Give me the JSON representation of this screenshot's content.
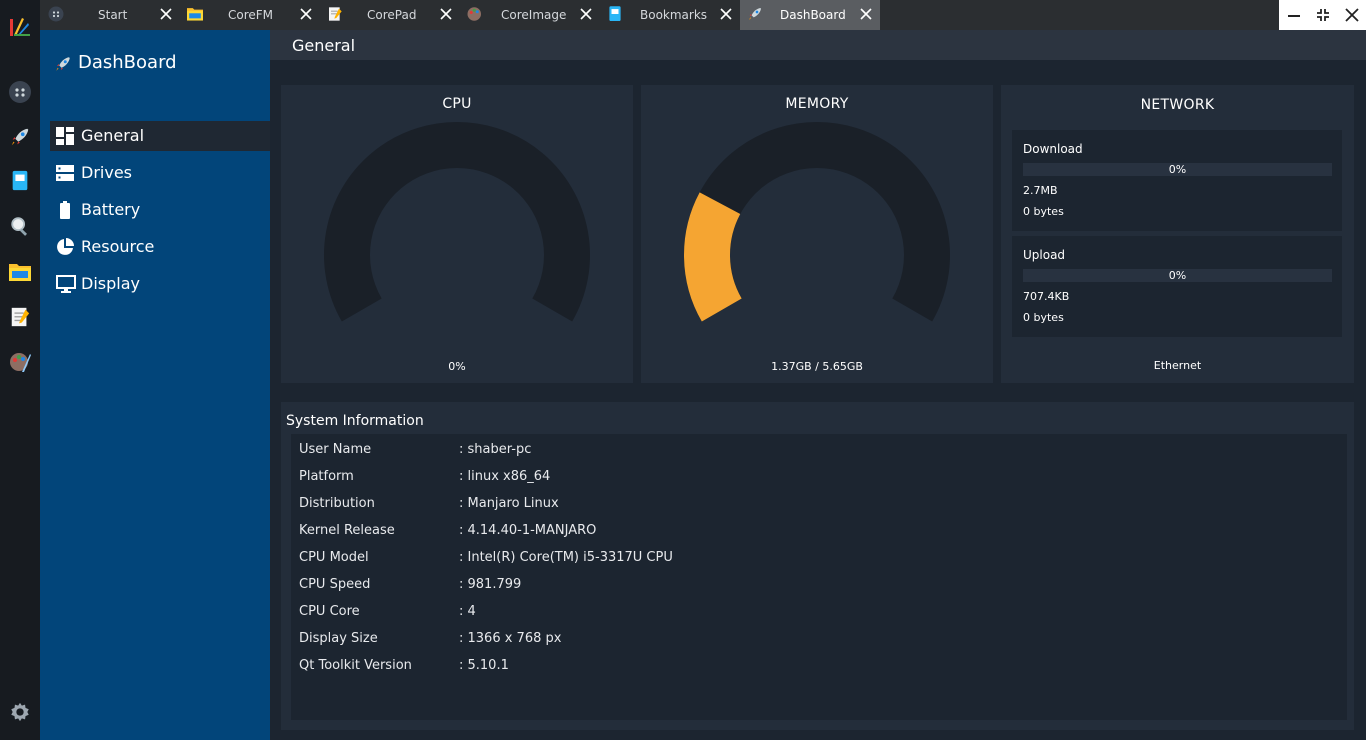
{
  "dock": {
    "items": [
      "corestuff-logo-icon",
      "start-icon",
      "dashboard-icon",
      "bookmarks-icon",
      "search-icon",
      "folder-icon",
      "notepad-icon",
      "coreimage-icon",
      "settings-icon"
    ]
  },
  "tabs": [
    {
      "label": "Start",
      "icon": "start-icon"
    },
    {
      "label": "CoreFM",
      "icon": "folder-icon"
    },
    {
      "label": "CorePad",
      "icon": "notepad-icon"
    },
    {
      "label": "CoreImage",
      "icon": "coreimage-icon"
    },
    {
      "label": "Bookmarks",
      "icon": "bookmarks-icon"
    },
    {
      "label": "DashBoard",
      "icon": "rocket-icon",
      "active": true
    }
  ],
  "sidebar": {
    "title": "DashBoard",
    "items": [
      {
        "label": "General",
        "icon": "grid-icon",
        "active": true
      },
      {
        "label": "Drives",
        "icon": "drives-icon"
      },
      {
        "label": "Battery",
        "icon": "battery-icon"
      },
      {
        "label": "Resource",
        "icon": "pie-icon"
      },
      {
        "label": "Display",
        "icon": "monitor-icon"
      }
    ]
  },
  "main": {
    "title": "General",
    "cpu": {
      "title": "CPU",
      "value": "0%",
      "fraction": 0.0
    },
    "memory": {
      "title": "MEMORY",
      "value": "1.37GB / 5.65GB",
      "fraction": 0.242
    },
    "network": {
      "title": "NETWORK",
      "download": {
        "label": "Download",
        "percent": "0%",
        "total": "2.7MB",
        "rate": "0 bytes"
      },
      "upload": {
        "label": "Upload",
        "percent": "0%",
        "total": "707.4KB",
        "rate": "0 bytes"
      },
      "interface": "Ethernet"
    },
    "sysinfo": {
      "title": "System Information",
      "rows": [
        {
          "key": "User Name",
          "value": ": shaber-pc"
        },
        {
          "key": "Platform",
          "value": ": linux x86_64"
        },
        {
          "key": "Distribution",
          "value": ": Manjaro Linux"
        },
        {
          "key": "Kernel Release",
          "value": ": 4.14.40-1-MANJARO"
        },
        {
          "key": "CPU Model",
          "value": ": Intel(R) Core(TM) i5-3317U CPU"
        },
        {
          "key": "CPU Speed",
          "value": ": 981.799"
        },
        {
          "key": "CPU Core",
          "value": ": 4"
        },
        {
          "key": "Display Size",
          "value": ": 1366 x 768 px"
        },
        {
          "key": "Qt Toolkit Version",
          "value": ": 5.10.1"
        }
      ]
    }
  },
  "colors": {
    "accent_gauge": "#f5a532",
    "gauge_track": "#1a2028",
    "sidebar": "#02457a"
  }
}
